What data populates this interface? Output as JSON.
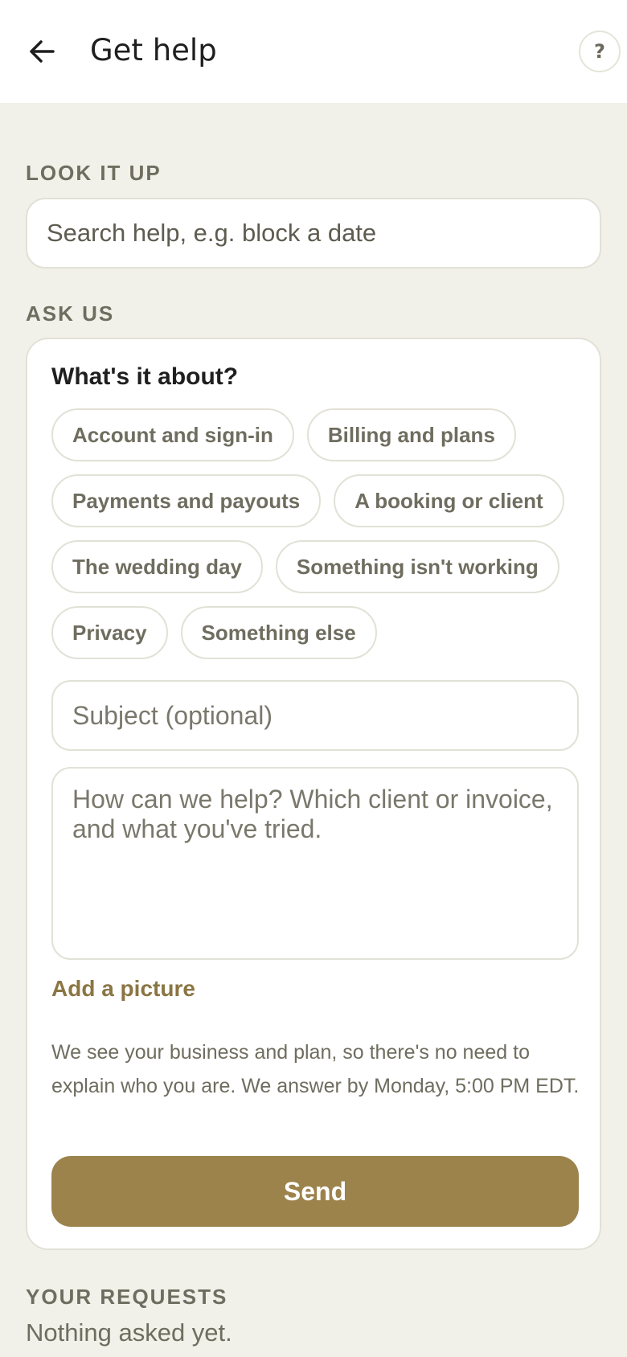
{
  "header": {
    "title": "Get help",
    "back_icon": "arrow-left-icon",
    "help_label": "?"
  },
  "lookup": {
    "section_label": "LOOK IT UP",
    "search_placeholder": "Search help, e.g. block a date"
  },
  "ask": {
    "section_label": "ASK US",
    "question": "What's it about?",
    "topics": [
      "Account and sign-in",
      "Billing and plans",
      "Payments and payouts",
      "A booking or client",
      "The wedding day",
      "Something isn't working",
      "Privacy",
      "Something else"
    ],
    "subject_placeholder": "Subject (optional)",
    "message_placeholder": "How can we help? Which client or invoice, and what you've tried.",
    "add_picture_label": "Add a picture",
    "note": "We see your business and plan, so there's no need to explain who you are. We answer by Monday, 5:00 PM EDT.",
    "send_label": "Send"
  },
  "requests": {
    "section_label": "YOUR REQUESTS",
    "empty_text": "Nothing asked yet."
  },
  "colors": {
    "background": "#f1f1e9",
    "accent": "#9c834c",
    "link": "#8a7543",
    "muted_text": "#6f6d5f"
  }
}
